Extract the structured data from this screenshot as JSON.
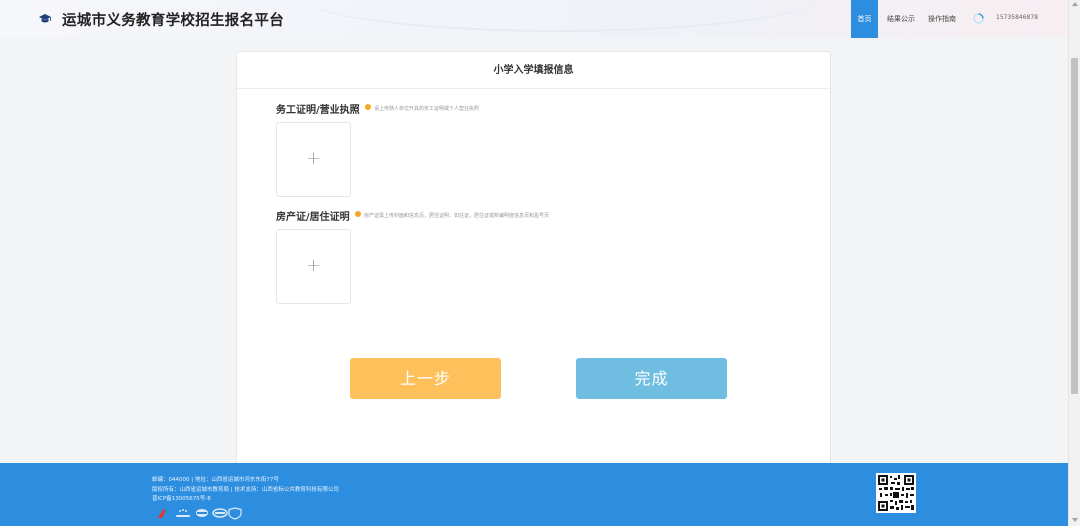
{
  "header": {
    "title": "运城市义务教育学校招生报名平台",
    "nav": [
      "首页",
      "结果公示",
      "操作指南"
    ],
    "user_phone": "15735846878",
    "caret": "⌄"
  },
  "card": {
    "title": "小学入学填报信息",
    "sections": [
      {
        "label": "务工证明/营业执照",
        "hint": "请上传随人单位开具的务工证明或个人营业执照"
      },
      {
        "label": "房产证/居住证明",
        "hint": "房产证需上传封面和信息页，居住证明：如住证，居住证或新编明度信息页和盈号页"
      }
    ],
    "upload_plus": "+",
    "prev_button": "上一步",
    "done_button": "完成"
  },
  "footer": {
    "line1": "邮编：044000 | 地址：山西省运城市河东东街77号",
    "line2": "版权所有：山西省运城市教育局 | 技术支持：山西省标公共教育科技有限公司",
    "line3": "晋ICP备13005675号-8"
  },
  "colors": {
    "accent_blue": "#2d8ee0",
    "prev_button": "#fec05b",
    "done_button": "#70bde2",
    "hint_dot": "#f5a623"
  }
}
